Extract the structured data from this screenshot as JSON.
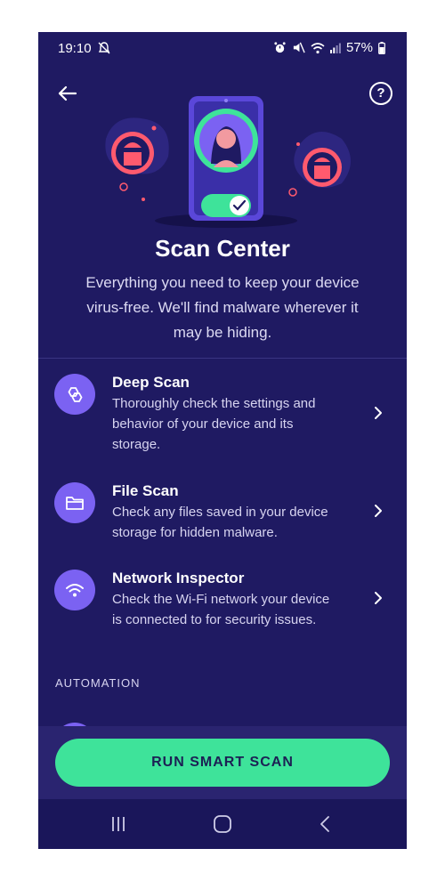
{
  "status_bar": {
    "time": "19:10",
    "battery": "57%"
  },
  "header": {
    "title": "Scan Center",
    "help": "?"
  },
  "intro": {
    "line1": "Everything you need to keep your device",
    "line2": "virus-free. We'll find malware wherever it",
    "line3": "may be hiding."
  },
  "items": [
    {
      "title": "Deep Scan",
      "desc_lines": [
        "Thoroughly check the settings and",
        "behavior of your device and its",
        "storage."
      ],
      "icon": "deep-scan-icon"
    },
    {
      "title": "File Scan",
      "desc_lines": [
        "Check any files saved in your device",
        "storage for hidden malware."
      ],
      "icon": "folder-icon"
    },
    {
      "title": "Network Inspector",
      "desc_lines": [
        "Check the Wi-Fi network your device",
        "is connected to for security issues."
      ],
      "icon": "wifi-icon"
    }
  ],
  "section_label": "AUTOMATION",
  "cta": {
    "label": "RUN SMART SCAN"
  },
  "colors": {
    "background": "#1f1a62",
    "accent_purple": "#7b62f2",
    "cta_green": "#3ee39a",
    "threat_red": "#ff5a6e"
  }
}
